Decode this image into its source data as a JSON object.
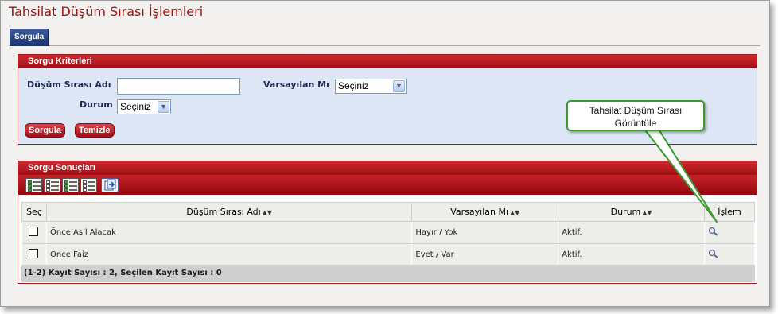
{
  "page_title": "Tahsilat Düşüm Sırası İşlemleri",
  "tab": {
    "label": "Sorgula"
  },
  "criteria": {
    "header": "Sorgu Kriterleri",
    "dusum_adi_label": "Düşüm Sırası Adı",
    "dusum_adi_value": "",
    "varsayilan_label": "Varsayılan Mı",
    "varsayilan_value": "Seçiniz",
    "durum_label": "Durum",
    "durum_value": "Seçiniz",
    "sorgula_button": "Sorgula",
    "temizle_button": "Temizle"
  },
  "results": {
    "header": "Sorgu Sonuçları",
    "toolbar_icons": [
      "select-all-icon",
      "deselect-all-icon",
      "select-page-icon",
      "deselect-page-icon",
      "export-icon"
    ],
    "columns": [
      "Seç",
      "Düşüm Sırası Adı",
      "Varsayılan Mı",
      "Durum",
      "İşlem"
    ],
    "rows": [
      {
        "adi": "Önce Asıl Alacak",
        "varsayilan": "Hayır / Yok",
        "durum": "Aktif."
      },
      {
        "adi": "Önce Faiz",
        "varsayilan": "Evet / Var",
        "durum": "Aktif."
      }
    ],
    "footer": "(1-2) Kayıt Sayısı : 2, Seçilen Kayıt Sayısı : 0"
  },
  "callout": {
    "text": "Tahsilat Düşüm Sırası Görüntüle"
  },
  "colors": {
    "brand_red": "#9e0f15",
    "tab_blue": "#1a3270",
    "callout_green": "#3a9a2f"
  }
}
